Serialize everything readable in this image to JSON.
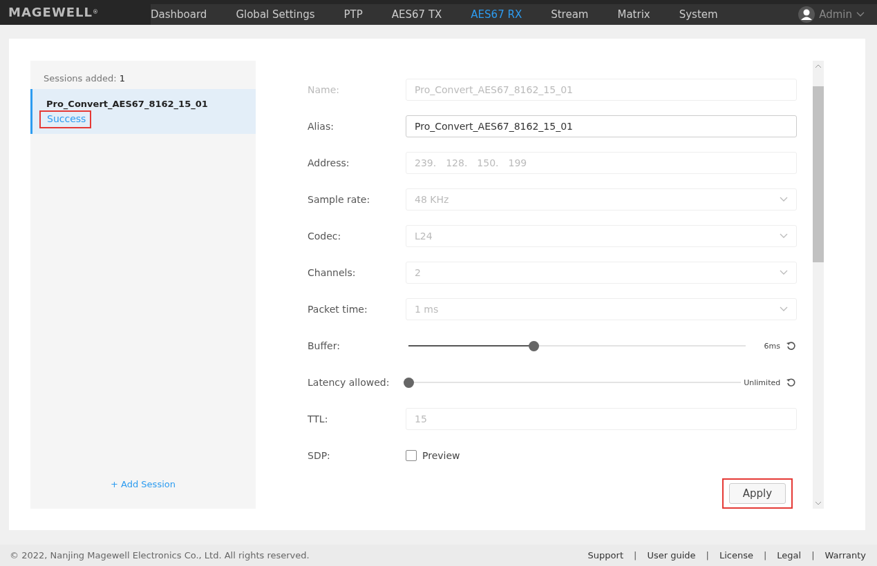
{
  "header": {
    "logo": "MAGEWELL",
    "logo_mark": "®",
    "nav": [
      {
        "label": "Dashboard",
        "selected": false
      },
      {
        "label": "Global Settings",
        "selected": false
      },
      {
        "label": "PTP",
        "selected": false
      },
      {
        "label": "AES67 TX",
        "selected": false
      },
      {
        "label": "AES67 RX",
        "selected": true
      },
      {
        "label": "Stream",
        "selected": false
      },
      {
        "label": "Matrix",
        "selected": false
      },
      {
        "label": "System",
        "selected": false
      }
    ],
    "user": "Admin"
  },
  "sidebar": {
    "count_label": "Sessions added:",
    "count": "1",
    "sessions": [
      {
        "name": "Pro_Convert_AES67_8162_15_01",
        "status": "Success",
        "selected": true,
        "highlighted": true
      }
    ],
    "add_label": "+ Add Session"
  },
  "form": {
    "fields": [
      {
        "kind": "text",
        "label": "Name:",
        "value": "Pro_Convert_AES67_8162_15_01",
        "disabled": true
      },
      {
        "kind": "text",
        "label": "Alias:",
        "value": "Pro_Convert_AES67_8162_15_01",
        "disabled": false
      },
      {
        "kind": "address",
        "label": "Address:",
        "octets": [
          "239.",
          "128.",
          "150.",
          "199"
        ]
      },
      {
        "kind": "select",
        "label": "Sample rate:",
        "value": "48 KHz"
      },
      {
        "kind": "select",
        "label": "Codec:",
        "value": "L24"
      },
      {
        "kind": "select",
        "label": "Channels:",
        "value": "2"
      },
      {
        "kind": "select",
        "label": "Packet time:",
        "value": "1 ms"
      },
      {
        "kind": "slider",
        "label": "Buffer:",
        "level": 0.37,
        "reading": "6ms"
      },
      {
        "kind": "slider",
        "label": "Latency allowed:",
        "level": 0,
        "reading": "Unlimited"
      },
      {
        "kind": "text",
        "label": "TTL:",
        "value": "15",
        "disabled": true
      },
      {
        "kind": "checkbox",
        "label": "SDP:",
        "option": "Preview",
        "checked": false
      }
    ],
    "apply": {
      "label": "Apply",
      "highlighted": true
    }
  },
  "footer": {
    "copyright": "© 2022, Nanjing Magewell Electronics Co., Ltd. All rights reserved.",
    "separator": "|",
    "links": [
      "Support",
      "User guide",
      "License",
      "Legal",
      "Warranty"
    ]
  }
}
